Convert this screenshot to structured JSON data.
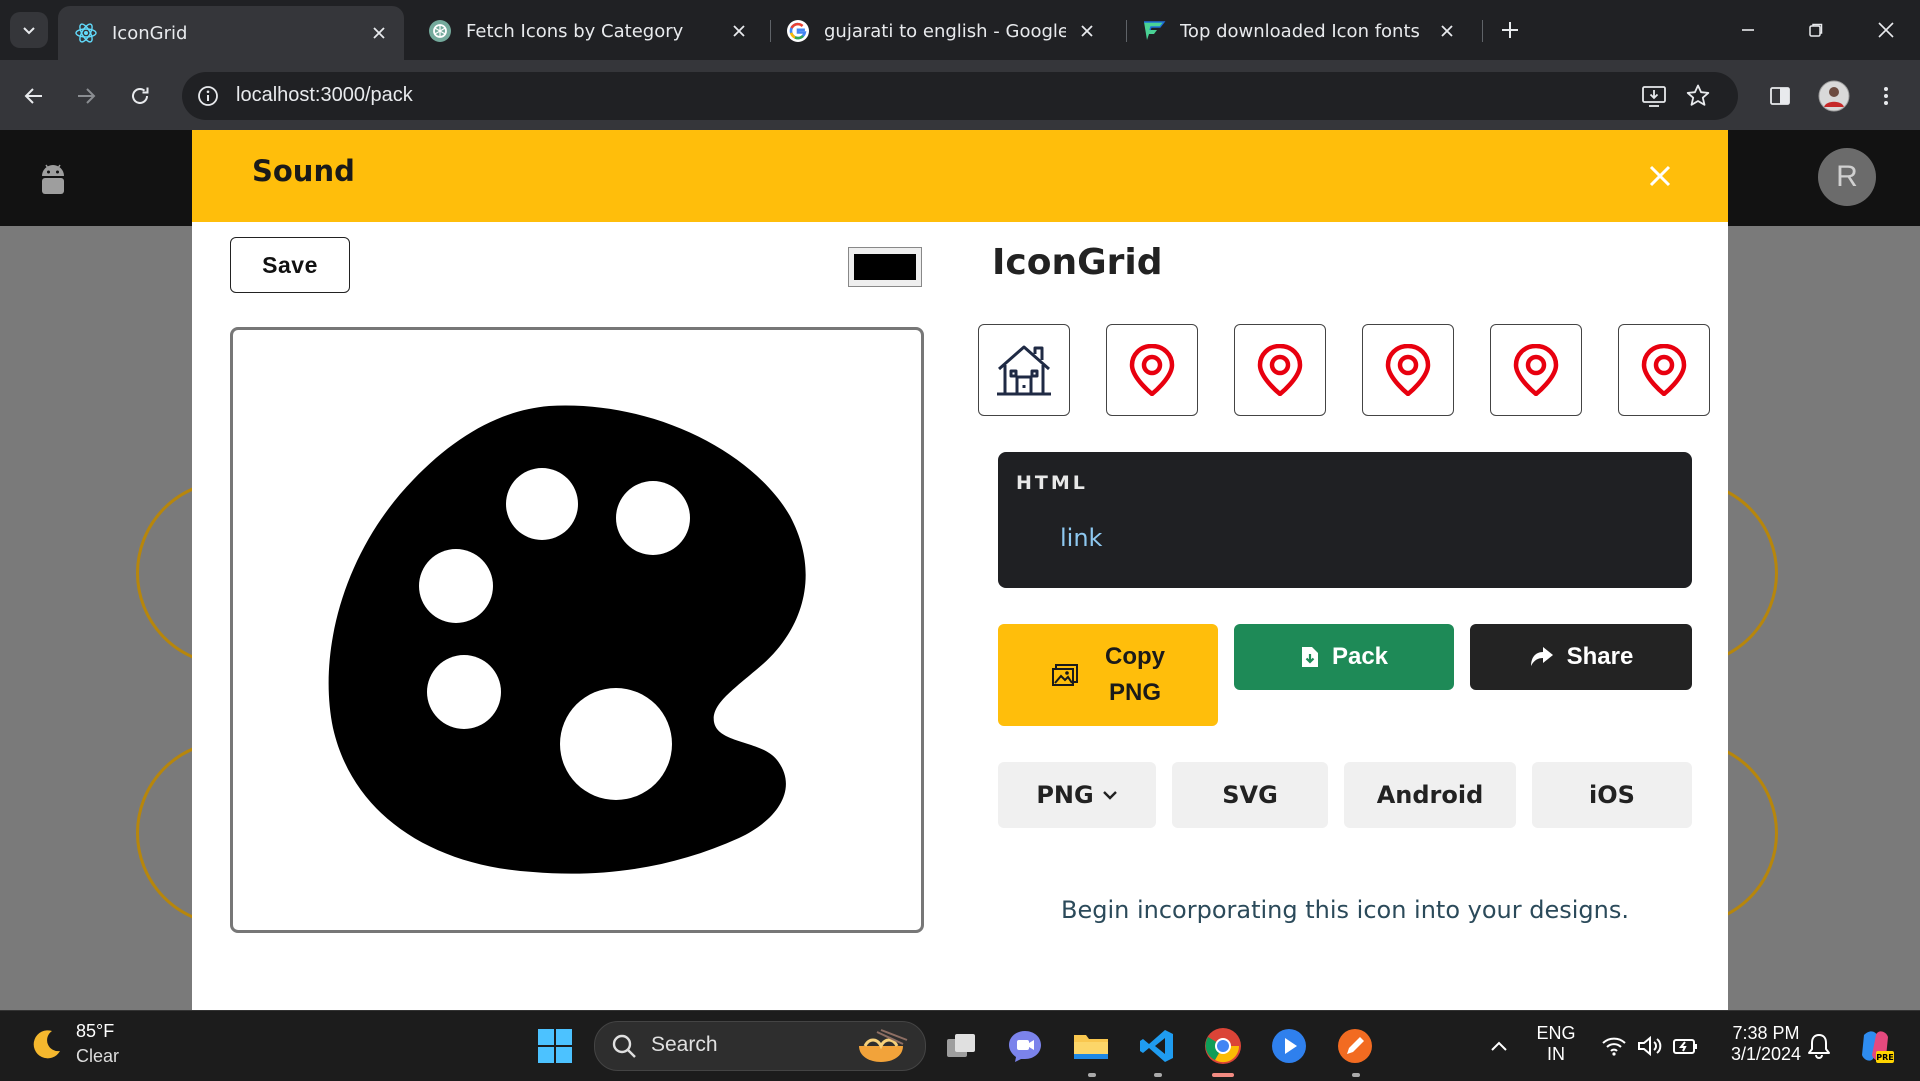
{
  "browser": {
    "tabs": [
      {
        "title": "IconGrid",
        "active": true,
        "favicon": "react-icon"
      },
      {
        "title": "Fetch Icons by Category",
        "active": false,
        "favicon": "chatgpt-icon"
      },
      {
        "title": "gujarati to english - Google Sea",
        "active": false,
        "favicon": "google-icon"
      },
      {
        "title": "Top downloaded Icon fonts - Fl",
        "active": false,
        "favicon": "flaticon-icon"
      }
    ],
    "url": "localhost:3000/pack"
  },
  "app": {
    "avatar_letter": "R"
  },
  "modal": {
    "title": "Sound",
    "save_label": "Save",
    "selected_color": "#000000",
    "preview_icon": "palette-icon",
    "grid_title": "IconGrid",
    "grid_icons": [
      "house-icon",
      "map-pin-icon",
      "map-pin-icon",
      "map-pin-icon",
      "map-pin-icon",
      "map-pin-icon"
    ],
    "code_label": "HTML",
    "code_link": "link",
    "actions": {
      "copy_line1": "Copy",
      "copy_line2": "PNG",
      "pack": "Pack",
      "share": "Share"
    },
    "formats": [
      "PNG",
      "SVG",
      "Android",
      "iOS"
    ],
    "hint": "Begin incorporating this icon into your designs."
  },
  "taskbar": {
    "weather_temp": "85°F",
    "weather_cond": "Clear",
    "search_label": "Search",
    "lang_line1": "ENG",
    "lang_line2": "IN",
    "time": "7:38 PM",
    "date": "3/1/2024"
  },
  "colors": {
    "accent_yellow": "#ffbe0b",
    "pack_green": "#1e8a57",
    "share_dark": "#232323",
    "pin_red": "#e8000f"
  }
}
